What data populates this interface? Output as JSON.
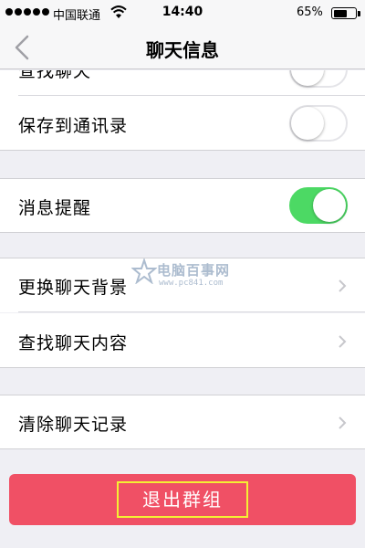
{
  "status_bar": {
    "carrier": "中国联通",
    "time": "14:40",
    "battery_percent": "65%",
    "battery_level": 0.65
  },
  "nav": {
    "title": "聊天信息"
  },
  "settings": {
    "partial_row_label": "查找聊天",
    "save_to_contacts_label": "保存到通讯录",
    "save_to_contacts_on": false,
    "partial_row_toggle_on": false,
    "message_alert_label": "消息提醒",
    "message_alert_on": true,
    "change_background_label": "更换聊天背景",
    "search_content_label": "查找聊天内容",
    "clear_history_label": "清除聊天记录"
  },
  "watermark": {
    "name": "电脑百事网",
    "url": "www.pc841.com"
  },
  "actions": {
    "exit_group_label": "退出群组"
  },
  "colors": {
    "toggle_on": "#4cd964",
    "exit_button": "#f05065",
    "highlight_box": "#f4f033"
  },
  "icons": [
    "signal-dots-icon",
    "wifi-icon",
    "battery-icon",
    "back-chevron-icon",
    "disclosure-chevron-icon",
    "star-logo-icon"
  ]
}
